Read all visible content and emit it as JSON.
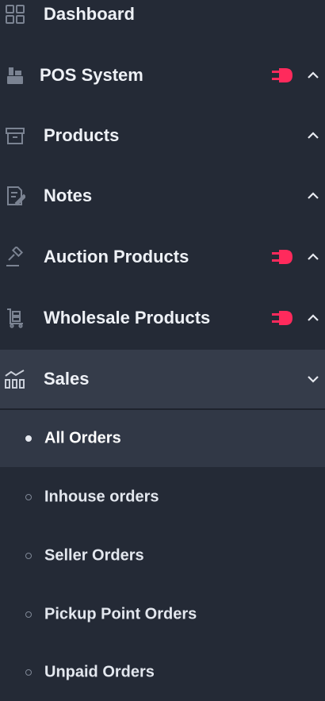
{
  "accent": "#ff2a5c",
  "menu": {
    "items": [
      {
        "label": "Dashboard",
        "icon": "grid-icon",
        "addon": false,
        "chevron": "none"
      },
      {
        "label": "POS System",
        "icon": "cash-register-icon",
        "addon": true,
        "chevron": "up"
      },
      {
        "label": "Products",
        "icon": "archive-box-icon",
        "addon": false,
        "chevron": "up"
      },
      {
        "label": "Notes",
        "icon": "note-edit-icon",
        "addon": false,
        "chevron": "up"
      },
      {
        "label": "Auction Products",
        "icon": "gavel-icon",
        "addon": true,
        "chevron": "up"
      },
      {
        "label": "Wholesale Products",
        "icon": "cart-stack-icon",
        "addon": true,
        "chevron": "up"
      },
      {
        "label": "Sales",
        "icon": "sales-chart-icon",
        "addon": false,
        "chevron": "down",
        "expanded": true
      }
    ],
    "sales_submenu": [
      {
        "label": "All Orders",
        "active": true
      },
      {
        "label": "Inhouse orders",
        "active": false
      },
      {
        "label": "Seller Orders",
        "active": false
      },
      {
        "label": "Pickup Point Orders",
        "active": false
      },
      {
        "label": "Unpaid Orders",
        "active": false
      }
    ]
  }
}
